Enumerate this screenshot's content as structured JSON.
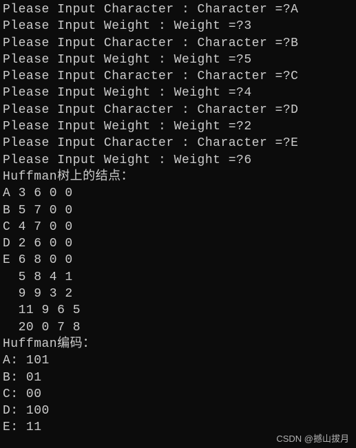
{
  "prompts": [
    {
      "prompt": "Please Input Character : Character =?",
      "answer": "A"
    },
    {
      "prompt": "Please Input Weight : Weight =?",
      "answer": "3"
    },
    {
      "prompt": "Please Input Character : Character =?",
      "answer": "B"
    },
    {
      "prompt": "Please Input Weight : Weight =?",
      "answer": "5"
    },
    {
      "prompt": "Please Input Character : Character =?",
      "answer": "C"
    },
    {
      "prompt": "Please Input Weight : Weight =?",
      "answer": "4"
    },
    {
      "prompt": "Please Input Character : Character =?",
      "answer": "D"
    },
    {
      "prompt": "Please Input Weight : Weight =?",
      "answer": "2"
    },
    {
      "prompt": "Please Input Character : Character =?",
      "answer": "E"
    },
    {
      "prompt": "Please Input Weight : Weight =?",
      "answer": "6"
    }
  ],
  "tree_header": "Huffman树上的结点：",
  "tree_nodes": [
    "A 3 6 0 0",
    "B 5 7 0 0",
    "C 4 7 0 0",
    "D 2 6 0 0",
    "E 6 8 0 0",
    "  5 8 4 1",
    "  9 9 3 2",
    "  11 9 6 5",
    "  20 0 7 8"
  ],
  "code_header": "Huffman编码：",
  "codes": [
    "A: 101",
    "B: 01",
    "C: 00",
    "D: 100",
    "E: 11"
  ],
  "watermark": "CSDN @撼山拔月"
}
